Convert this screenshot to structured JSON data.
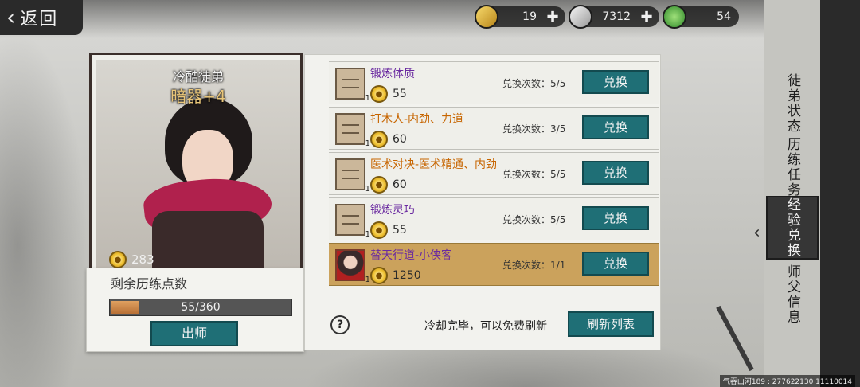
{
  "back": {
    "label": "返回"
  },
  "currencies": [
    {
      "icon": "gold-ingot-icon",
      "value": "19"
    },
    {
      "icon": "silver-ingot-icon",
      "value": "7312"
    },
    {
      "icon": "jade-icon",
      "value": "54"
    }
  ],
  "character": {
    "title": "冷酷徒弟",
    "subtitle": "暗器+4",
    "points": "283"
  },
  "remaining": {
    "label": "剩余历练点数",
    "progress_text": "55/360",
    "progress_fraction": 0.153,
    "graduate_label": "出师"
  },
  "exchange": {
    "count_prefix": "兑换次数：",
    "items": [
      {
        "name": "锻炼体质",
        "name_color": "purple",
        "cost": "55",
        "count": "5/5",
        "button": "兑换",
        "highlight": false,
        "icon": "scroll-icon"
      },
      {
        "name": "打木人-内劲、力道",
        "name_color": "orange",
        "cost": "60",
        "count": "3/5",
        "button": "兑换",
        "highlight": false,
        "icon": "scroll-icon"
      },
      {
        "name": "医术对决-医术精通、内劲",
        "name_color": "orange",
        "cost": "60",
        "count": "5/5",
        "button": "兑换",
        "highlight": false,
        "icon": "scroll-icon"
      },
      {
        "name": "锻炼灵巧",
        "name_color": "purple",
        "cost": "55",
        "count": "5/5",
        "button": "兑换",
        "highlight": false,
        "icon": "scroll-icon"
      },
      {
        "name": "替天行道-小侠客",
        "name_color": "purple",
        "cost": "1250",
        "count": "1/1",
        "button": "兑换",
        "highlight": true,
        "icon": "hero-icon"
      }
    ],
    "refresh_note": "冷却完毕，可以免费刷新",
    "refresh_button": "刷新列表"
  },
  "tabs": [
    {
      "label": "徒弟状态",
      "active": false
    },
    {
      "label": "历练任务",
      "active": false
    },
    {
      "label": "经验兑换",
      "active": true
    },
    {
      "label": "师父信息",
      "active": false
    }
  ],
  "footer": "气吞山河189 : 277622130 11110014"
}
